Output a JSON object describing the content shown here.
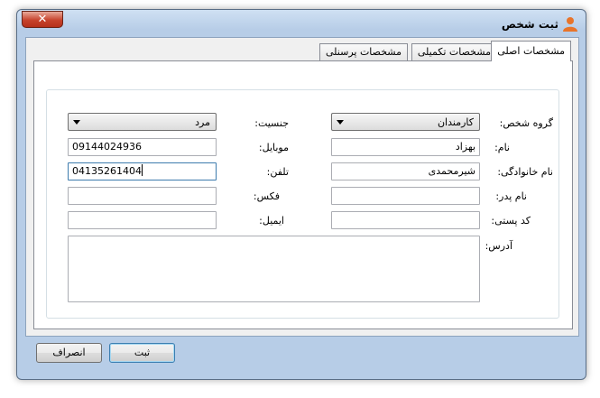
{
  "window": {
    "title": "ثبت شخص",
    "close_label": "✕"
  },
  "tabs": [
    {
      "label": "مشخصات اصلی",
      "active": true
    },
    {
      "label": "مشخصات تکمیلی",
      "active": false
    },
    {
      "label": "مشخصات پرسنلی",
      "active": false
    }
  ],
  "form": {
    "person_group": {
      "label": "گروه شخص:",
      "value": "کارمندان"
    },
    "gender": {
      "label": "جنسیت:",
      "value": "مرد"
    },
    "first_name": {
      "label": "نام:",
      "value": "بهزاد"
    },
    "mobile": {
      "label": "موبایل:",
      "value": "09144024936"
    },
    "last_name": {
      "label": "نام خانوادگی:",
      "value": "شیرمحمدی"
    },
    "phone": {
      "label": "تلفن:",
      "value": "04135261404"
    },
    "father_name": {
      "label": "نام پدر:",
      "value": ""
    },
    "fax": {
      "label": "فکس:",
      "value": ""
    },
    "postal_code": {
      "label": "کد پستی:",
      "value": ""
    },
    "email": {
      "label": "ایمیل:",
      "value": ""
    },
    "address": {
      "label": "آدرس:",
      "value": ""
    }
  },
  "buttons": {
    "submit": "ثبت",
    "cancel": "انصراف"
  },
  "colors": {
    "title_bar": "#b7cde7",
    "close_button": "#c7432c",
    "icon_orange": "#e8742a"
  }
}
